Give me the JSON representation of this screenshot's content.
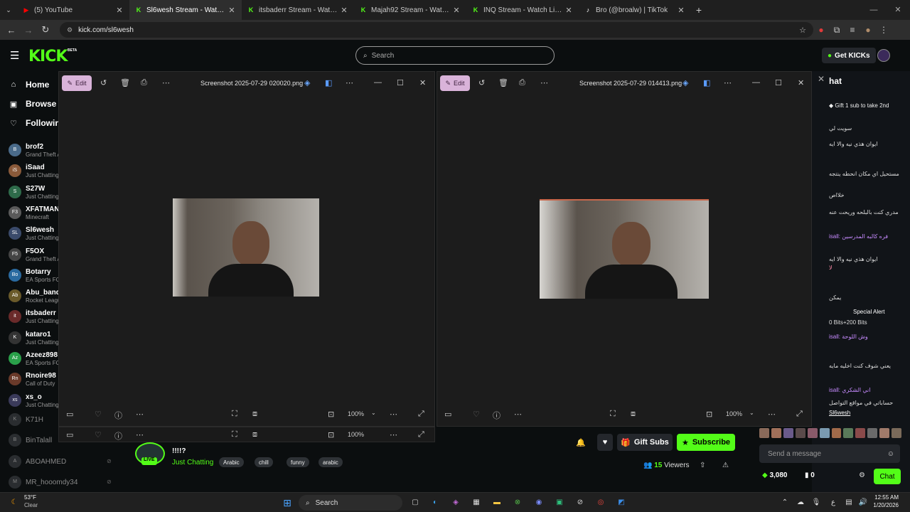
{
  "browser": {
    "tabs": [
      {
        "title": "(5) YouTube",
        "favicon": "youtube-icon",
        "color": "#ff0000"
      },
      {
        "title": "Sl6wesh Stream - Watch Live on Kick",
        "favicon": "kick-icon",
        "color": "#53fc18"
      },
      {
        "title": "itsbaderr Stream - Watch Live on Kick",
        "favicon": "kick-icon",
        "color": "#53fc18"
      },
      {
        "title": "Majah92 Stream - Watch Live on Kick",
        "favicon": "kick-icon",
        "color": "#53fc18"
      },
      {
        "title": "INQ Stream - Watch Live on Kick",
        "favicon": "kick-icon",
        "color": "#53fc18"
      },
      {
        "title": "Bro (@broalw) | TikTok",
        "favicon": "tiktok-icon",
        "color": "#ffffff"
      }
    ],
    "url": "kick.com/sl6wesh"
  },
  "kick": {
    "logo": "KICK",
    "beta": "BETA",
    "search_placeholder": "Search",
    "get_kicks": "Get KICKs",
    "accent": "#53fc18",
    "nav": {
      "home": "Home",
      "browse": "Browse",
      "following": "Following"
    },
    "channels": [
      {
        "name": "brof2",
        "category": "Grand Theft Auto V",
        "initials": "B"
      },
      {
        "name": "iSaad",
        "category": "Just Chatting",
        "initials": "iS"
      },
      {
        "name": "S27W",
        "category": "Just Chatting",
        "initials": "S"
      },
      {
        "name": "XFATMAN",
        "category": "Minecraft",
        "initials": "F3"
      },
      {
        "name": "Sl6wesh",
        "category": "Just Chatting",
        "initials": "SL"
      },
      {
        "name": "F5OX",
        "category": "Grand Theft Auto V",
        "initials": "F5"
      },
      {
        "name": "Botarry",
        "category": "EA Sports FC 25",
        "initials": "Bo"
      },
      {
        "name": "Abu_bandar",
        "category": "Rocket League",
        "initials": "Ab"
      },
      {
        "name": "itsbaderr",
        "category": "Just Chatting",
        "initials": "it"
      },
      {
        "name": "kataro1",
        "category": "Just Chatting",
        "initials": "K"
      },
      {
        "name": "Azeez898",
        "category": "EA Sports FC 25",
        "initials": "Az"
      },
      {
        "name": "Rnoire98",
        "category": "Call of Duty",
        "initials": "Rn"
      },
      {
        "name": "xs_o",
        "category": "Just Chatting",
        "initials": "xs"
      }
    ],
    "offline_channels": [
      {
        "name": "K71H",
        "initials": "K"
      },
      {
        "name": "BinTalall",
        "initials": "B"
      },
      {
        "name": "ABOAHMED",
        "initials": "A"
      },
      {
        "name": "MR_hooomdy34",
        "initials": "M"
      }
    ]
  },
  "photo_windows": [
    {
      "title": "Screenshot 2025-07-29 020020.png",
      "edit": "Edit",
      "zoom": "100%"
    },
    {
      "title": "Screenshot 2025-07-29 014413.png",
      "edit": "Edit",
      "zoom": "100%"
    }
  ],
  "stream": {
    "title_fragment": "!!!!?",
    "live": "LIVE",
    "category": "Just Chatting",
    "tags": [
      "Arabic",
      "chill",
      "funny",
      "arabic"
    ],
    "viewers_count": "15",
    "viewers_label": "Viewers",
    "gift_subs": "Gift Subs",
    "subscribe": "Subscribe"
  },
  "chat": {
    "header": "hat",
    "pinned": "Gift 1 sub to take 2nd",
    "messages": [
      "سويت لي",
      "ايوان هذي نيه والا ايه",
      "مستحيل اي مكان انحطه ينتجه",
      "خلااص",
      "مدري كنت بالبلحه وريحت عنه",
      "isall: فره كالبه المدرسين",
      "ايوان هذي نيه والا ايه",
      "لا",
      "يمكن",
      "Special Alert",
      "0 Bits+200 Bits",
      "isall: وش اللوحة",
      "يعني شوف كنت اخليه مايه",
      "isall: اني الشكري",
      "حساباتي في مواقع التواصل",
      "Sl6wesh"
    ],
    "input_placeholder": "Send a message",
    "points": "3,080",
    "zero": "0",
    "chat_button": "Chat"
  },
  "taskbar": {
    "weather_temp": "53°F",
    "weather_desc": "Clear",
    "search": "Search",
    "time": "12:55 AM",
    "date": "1/20/2026"
  }
}
